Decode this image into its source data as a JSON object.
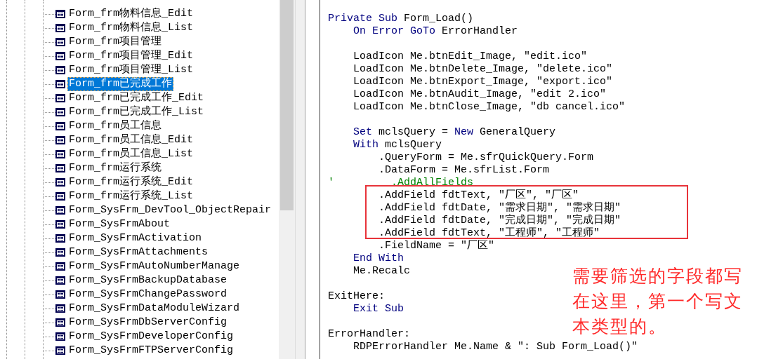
{
  "tree": {
    "items": [
      {
        "label": "Form_frm物料信息_Edit",
        "selected": false
      },
      {
        "label": "Form_frm物料信息_List",
        "selected": false
      },
      {
        "label": "Form_frm项目管理",
        "selected": false
      },
      {
        "label": "Form_frm项目管理_Edit",
        "selected": false
      },
      {
        "label": "Form_frm项目管理_List",
        "selected": false
      },
      {
        "label": "Form_frm已完成工作",
        "selected": true
      },
      {
        "label": "Form_frm已完成工作_Edit",
        "selected": false
      },
      {
        "label": "Form_frm已完成工作_List",
        "selected": false
      },
      {
        "label": "Form_frm员工信息",
        "selected": false
      },
      {
        "label": "Form_frm员工信息_Edit",
        "selected": false
      },
      {
        "label": "Form_frm员工信息_List",
        "selected": false
      },
      {
        "label": "Form_frm运行系统",
        "selected": false
      },
      {
        "label": "Form_frm运行系统_Edit",
        "selected": false
      },
      {
        "label": "Form_frm运行系统_List",
        "selected": false
      },
      {
        "label": "Form_SysFrm_DevTool_ObjectRepair",
        "selected": false
      },
      {
        "label": "Form_SysFrmAbout",
        "selected": false
      },
      {
        "label": "Form_SysFrmActivation",
        "selected": false
      },
      {
        "label": "Form_SysFrmAttachments",
        "selected": false
      },
      {
        "label": "Form_SysFrmAutoNumberManage",
        "selected": false
      },
      {
        "label": "Form_SysFrmBackupDatabase",
        "selected": false
      },
      {
        "label": "Form_SysFrmChangePassword",
        "selected": false
      },
      {
        "label": "Form_SysFrmDataModuleWizard",
        "selected": false
      },
      {
        "label": "Form_SysFrmDbServerConfig",
        "selected": false
      },
      {
        "label": "Form_SysFrmDeveloperConfig",
        "selected": false
      },
      {
        "label": "Form_SysFrmFTPServerConfig",
        "selected": false
      }
    ]
  },
  "editor": {
    "lines": [
      {
        "kind": "code",
        "tokens": [
          {
            "kind": "keyword",
            "text": "Private Sub"
          },
          {
            "kind": "plain",
            "text": " Form_Load()"
          }
        ]
      },
      {
        "kind": "code",
        "tokens": [
          {
            "kind": "keyword",
            "text": "    On Error GoTo"
          },
          {
            "kind": "plain",
            "text": " ErrorHandler"
          }
        ]
      },
      {
        "kind": "blank"
      },
      {
        "kind": "code",
        "tokens": [
          {
            "kind": "plain",
            "text": "    LoadIcon Me.btnEdit_Image, \"edit.ico\""
          }
        ]
      },
      {
        "kind": "code",
        "tokens": [
          {
            "kind": "plain",
            "text": "    LoadIcon Me.btnDelete_Image, \"delete.ico\""
          }
        ]
      },
      {
        "kind": "code",
        "tokens": [
          {
            "kind": "plain",
            "text": "    LoadIcon Me.btnExport_Image, \"export.ico\""
          }
        ]
      },
      {
        "kind": "code",
        "tokens": [
          {
            "kind": "plain",
            "text": "    LoadIcon Me.btnAudit_Image, \"edit 2.ico\""
          }
        ]
      },
      {
        "kind": "code",
        "tokens": [
          {
            "kind": "plain",
            "text": "    LoadIcon Me.btnClose_Image, \"db cancel.ico\""
          }
        ]
      },
      {
        "kind": "blank"
      },
      {
        "kind": "code",
        "tokens": [
          {
            "kind": "keyword",
            "text": "    Set"
          },
          {
            "kind": "plain",
            "text": " mclsQuery = "
          },
          {
            "kind": "keyword",
            "text": "New"
          },
          {
            "kind": "plain",
            "text": " GeneralQuery"
          }
        ]
      },
      {
        "kind": "code",
        "tokens": [
          {
            "kind": "keyword",
            "text": "    With"
          },
          {
            "kind": "plain",
            "text": " mclsQuery"
          }
        ]
      },
      {
        "kind": "code",
        "tokens": [
          {
            "kind": "plain",
            "text": "        .QueryForm = Me.sfrQuickQuery.Form"
          }
        ]
      },
      {
        "kind": "code",
        "tokens": [
          {
            "kind": "plain",
            "text": "        .DataForm = Me.sfrList.Form"
          }
        ]
      },
      {
        "kind": "code",
        "tokens": [
          {
            "kind": "comment",
            "text": "'         .AddAllFields"
          }
        ]
      },
      {
        "kind": "code",
        "tokens": [
          {
            "kind": "plain",
            "text": "        .AddField fdtText, \"厂区\", \"厂区\""
          }
        ]
      },
      {
        "kind": "code",
        "tokens": [
          {
            "kind": "plain",
            "text": "        .AddField fdtDate, \"需求日期\", \"需求日期\""
          }
        ]
      },
      {
        "kind": "code",
        "tokens": [
          {
            "kind": "plain",
            "text": "        .AddField fdtDate, \"完成日期\", \"完成日期\""
          }
        ]
      },
      {
        "kind": "code",
        "tokens": [
          {
            "kind": "plain",
            "text": "        .AddField fdtText, \"工程师\", \"工程师\""
          }
        ]
      },
      {
        "kind": "code",
        "tokens": [
          {
            "kind": "plain",
            "text": "        .FieldName = \"厂区\""
          }
        ]
      },
      {
        "kind": "code",
        "tokens": [
          {
            "kind": "keyword",
            "text": "    End With"
          }
        ]
      },
      {
        "kind": "code",
        "tokens": [
          {
            "kind": "plain",
            "text": "    Me.Recalc"
          }
        ]
      },
      {
        "kind": "blank"
      },
      {
        "kind": "code",
        "tokens": [
          {
            "kind": "plain",
            "text": "ExitHere:"
          }
        ]
      },
      {
        "kind": "code",
        "tokens": [
          {
            "kind": "keyword",
            "text": "    Exit Sub"
          }
        ]
      },
      {
        "kind": "blank"
      },
      {
        "kind": "code",
        "tokens": [
          {
            "kind": "plain",
            "text": "ErrorHandler:"
          }
        ]
      },
      {
        "kind": "code",
        "tokens": [
          {
            "kind": "plain",
            "text": "    RDPErrorHandler Me.Name & \": Sub Form_Load()\""
          }
        ]
      }
    ]
  },
  "annotation": {
    "text": "需要筛选的字段都写在这里，第一个写文本类型的。"
  }
}
